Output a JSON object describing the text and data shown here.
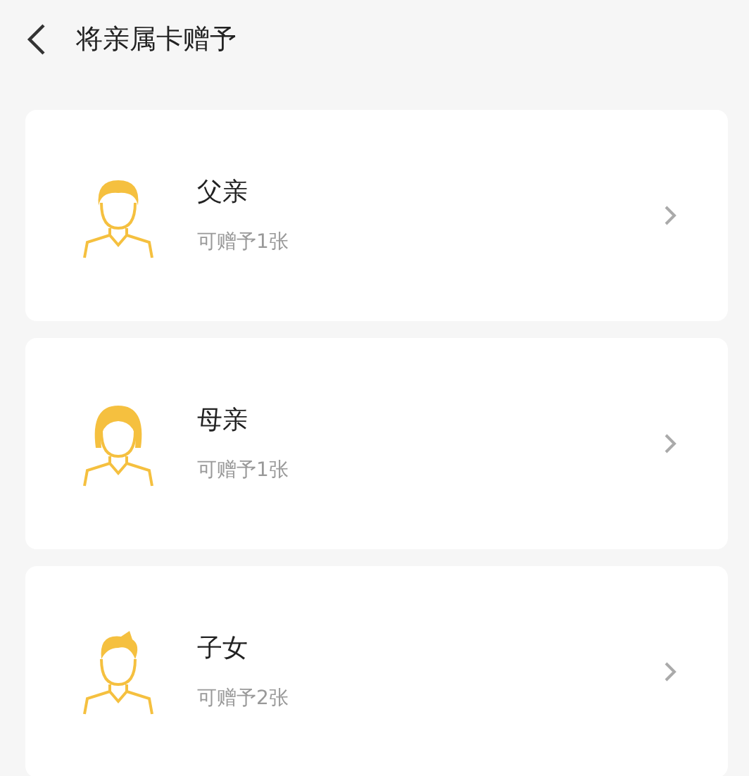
{
  "header": {
    "title": "将亲属卡赠予"
  },
  "members": [
    {
      "kind": "father",
      "name": "父亲",
      "subtitle": "可赠予1张"
    },
    {
      "kind": "mother",
      "name": "母亲",
      "subtitle": "可赠予1张"
    },
    {
      "kind": "child",
      "name": "子女",
      "subtitle": "可赠予2张"
    }
  ]
}
